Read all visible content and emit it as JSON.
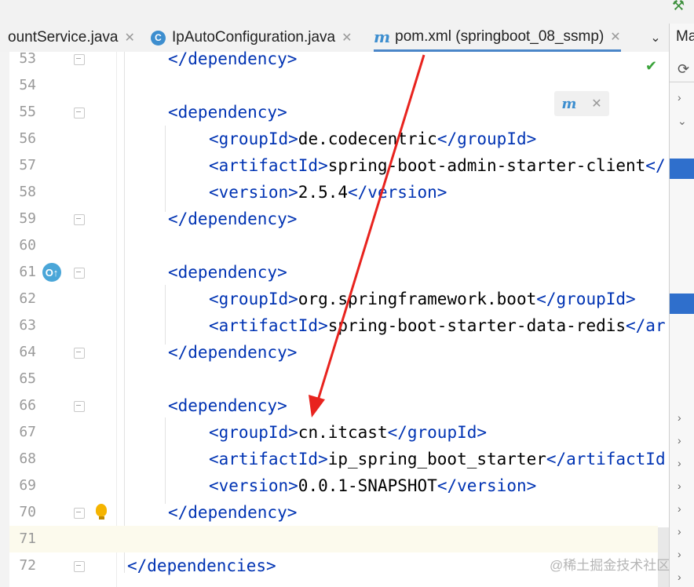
{
  "tabs": [
    {
      "label": "ountService.java",
      "icon": "none"
    },
    {
      "label": "IpAutoConfiguration.java",
      "icon": "class-icon"
    },
    {
      "label": "pom.xml (springboot_08_ssmp)",
      "icon": "maven-icon",
      "active": true
    }
  ],
  "tab_close_glyph": "✕",
  "right_panel": {
    "title": "Ma"
  },
  "editor": {
    "lines": [
      {
        "num": "53",
        "text": "</dependency>"
      },
      {
        "num": "54",
        "text": ""
      },
      {
        "num": "55",
        "text": "<dependency>"
      },
      {
        "num": "56",
        "open": "<groupId>",
        "value": "de.codecentric",
        "close": "</groupId>"
      },
      {
        "num": "57",
        "open": "<artifactId>",
        "value": "spring-boot-admin-starter-client",
        "close": "</"
      },
      {
        "num": "58",
        "open": "<version>",
        "value": "2.5.4",
        "close": "</version>"
      },
      {
        "num": "59",
        "text": "</dependency>"
      },
      {
        "num": "60",
        "text": ""
      },
      {
        "num": "61",
        "text": "<dependency>"
      },
      {
        "num": "62",
        "open": "<groupId>",
        "value": "org.springframework.boot",
        "close": "</groupId>"
      },
      {
        "num": "63",
        "open": "<artifactId>",
        "value": "spring-boot-starter-data-redis",
        "close": "</ar"
      },
      {
        "num": "64",
        "text": "</dependency>"
      },
      {
        "num": "65",
        "text": ""
      },
      {
        "num": "66",
        "text": "<dependency>"
      },
      {
        "num": "67",
        "open": "<groupId>",
        "value": "cn.itcast",
        "close": "</groupId>"
      },
      {
        "num": "68",
        "open": "<artifactId>",
        "value": "ip_spring_boot_starter",
        "close": "</artifactId"
      },
      {
        "num": "69",
        "open": "<version>",
        "value": "0.0.1-SNAPSHOT",
        "close": "</version>"
      },
      {
        "num": "70",
        "text": "</dependency>"
      },
      {
        "num": "71",
        "text": ""
      },
      {
        "num": "72",
        "text": "</dependencies>"
      }
    ]
  },
  "watermark": "@稀土掘金技术社区",
  "colors": {
    "tag": "#0033b3",
    "arrow": "#e8231e",
    "accent": "#4a86c8"
  }
}
